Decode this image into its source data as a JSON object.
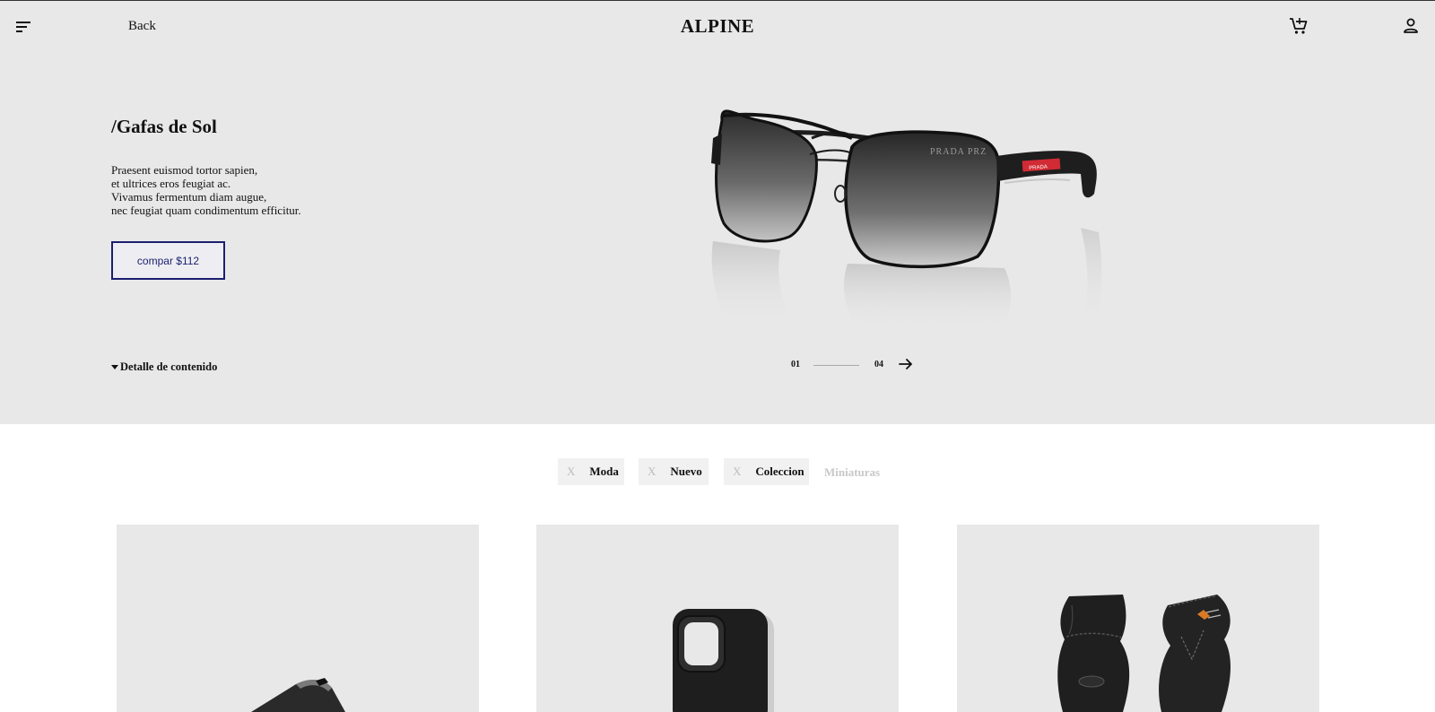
{
  "header": {
    "back_label": "Back",
    "brand": "ALPINE",
    "menu_icon": "menu-icon",
    "cart_icon": "cart-icon",
    "user_icon": "user-icon"
  },
  "hero": {
    "title": "/Gafas de Sol",
    "description": [
      "Praesent euismod tortor sapien,",
      "et ultrices eros feugiat ac.",
      "Vivamus fermentum diam augue,",
      "nec feugiat quam condimentum efficitur."
    ],
    "buy_label": "compar $112",
    "detail_label": "Detalle de contenido",
    "product_image": "sunglasses-image",
    "lens_brand_text": "PRADA PRZ",
    "temple_brand_text": "PRADA",
    "slider": {
      "current": "01",
      "total": "04",
      "next_icon": "arrow-right-icon"
    }
  },
  "filters": {
    "remove_symbol": "X",
    "chips": [
      {
        "label": "Moda"
      },
      {
        "label": "Nuevo"
      },
      {
        "label": "Coleccion"
      }
    ],
    "extra": "Miniaturas"
  },
  "products": [
    {
      "image": "watch-image"
    },
    {
      "image": "phone-case-image"
    },
    {
      "image": "gloves-image"
    }
  ],
  "colors": {
    "hero_bg": "#e8e8e9",
    "accent": "#1b1f6e",
    "chip_bg": "#f1f1f1",
    "muted": "#c8c8c8"
  }
}
